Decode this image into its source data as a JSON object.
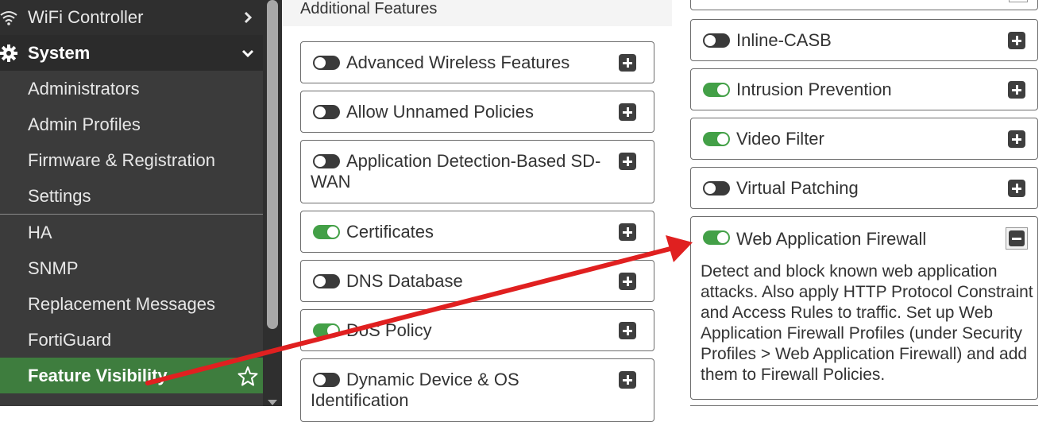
{
  "sidebar": {
    "wifi_controller": "WiFi Controller",
    "system": "System",
    "items": [
      {
        "label": "Administrators"
      },
      {
        "label": "Admin Profiles"
      },
      {
        "label": "Firmware & Registration"
      },
      {
        "label": "Settings"
      },
      {
        "label": "HA"
      },
      {
        "label": "SNMP"
      },
      {
        "label": "Replacement Messages"
      },
      {
        "label": "FortiGuard"
      },
      {
        "label": "Feature Visibility"
      }
    ],
    "active_color": "#3e7d3e"
  },
  "main": {
    "section_title": "Additional Features",
    "left_features": [
      {
        "label": "Advanced Wireless Features",
        "enabled": false
      },
      {
        "label": "Allow Unnamed Policies",
        "enabled": false
      },
      {
        "label": "Application Detection-Based SD-WAN",
        "enabled": false
      },
      {
        "label": "Certificates",
        "enabled": true
      },
      {
        "label": "DNS Database",
        "enabled": false
      },
      {
        "label": "DoS Policy",
        "enabled": true
      },
      {
        "label": "Dynamic Device & OS Identification",
        "enabled": false
      }
    ],
    "right_features": [
      {
        "label": "Inline-CASB",
        "enabled": false
      },
      {
        "label": "Intrusion Prevention",
        "enabled": true
      },
      {
        "label": "Video Filter",
        "enabled": true
      },
      {
        "label": "Virtual Patching",
        "enabled": false
      },
      {
        "label": "Web Application Firewall",
        "enabled": true,
        "expanded": true,
        "description": "Detect and block known web application attacks. Also apply HTTP Protocol Constraint and Access Rules to traffic. Set up Web Application Firewall Profiles (under Security Profiles > Web Application Firewall) and add them to Firewall Policies."
      }
    ]
  },
  "colors": {
    "toggle_on": "#43a047",
    "toggle_off": "#3a3a3a",
    "annotation_arrow": "#e02020"
  },
  "icons": {
    "wifi": "wifi-icon",
    "system": "gear-icon",
    "favorite": "star-icon",
    "expand": "plus-icon",
    "collapse": "minus-icon"
  }
}
